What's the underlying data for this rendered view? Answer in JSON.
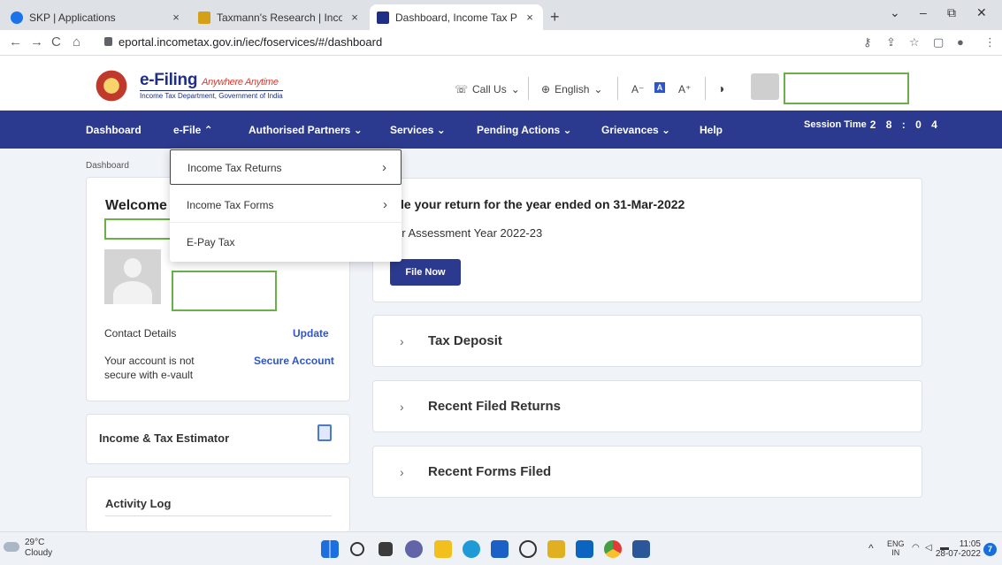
{
  "browser": {
    "tabs": [
      {
        "title": "SKP | Applications",
        "close": "×",
        "favicon_color": "#1a73e8"
      },
      {
        "title": "Taxmann's Research | Income Tax",
        "close": "×",
        "favicon_color": "#d4a017"
      },
      {
        "title": "Dashboard, Income Tax Portal, G",
        "close": "×",
        "favicon_color": "#1f2f86"
      }
    ],
    "new_tab": "+",
    "window_controls": [
      "⌄",
      "–",
      "⧉",
      "✕"
    ],
    "nav_buttons": [
      "←",
      "→",
      "C",
      "⌂"
    ],
    "url": "eportal.incometax.gov.in/iec/foservices/#/dashboard",
    "toolbar_icons": [
      "⚷",
      "⇪",
      "☆",
      "▢",
      "●",
      "⋮"
    ]
  },
  "site": {
    "logo_text": "e-Filing",
    "logo_tagline": "Anywhere Anytime",
    "logo_sub": "Income Tax Department, Government of India",
    "call_us": "Call Us",
    "language": "English",
    "font_controls": [
      "A⁻",
      "A",
      "A⁺"
    ],
    "contrast_icon": "◑"
  },
  "nav": {
    "items": [
      "Dashboard",
      "e-File ⌃",
      "Authorised Partners ⌄",
      "Services ⌄",
      "Pending Actions ⌄",
      "Grievances ⌄",
      "Help"
    ],
    "session_label": "Session Time",
    "session_digits": "2 8 : 0 4"
  },
  "dropdown": {
    "items": [
      "Income Tax Returns",
      "Income Tax Forms",
      "E-Pay Tax"
    ],
    "chevron": "›"
  },
  "main": {
    "breadcrumb": "Dashboard",
    "welcome": "Welcome I",
    "contact_label": "Contact Details",
    "update_link": "Update",
    "account_msg_1": "Your account is not",
    "account_msg_2": "secure with e-vault",
    "secure_link": "Secure Account",
    "estimator": "Income & Tax Estimator",
    "activity_log": "Activity Log",
    "banner_title": "le your return for the year ended on 31-Mar-2022",
    "banner_sub": "or Assessment Year 2022-23",
    "file_now": "File Now",
    "accordions": [
      "Tax Deposit",
      "Recent Filed Returns",
      "Recent Forms Filed"
    ],
    "accordion_chevron": "›"
  },
  "taskbar": {
    "temp": "29°C",
    "weather": "Cloudy",
    "lang_1": "ENG",
    "lang_2": "IN",
    "time": "11:05",
    "date": "28-07-2022",
    "notifications": "7",
    "tray_caret": "^"
  },
  "colors": {
    "nav_bg": "#2b3a8e",
    "link": "#2f55c7",
    "redaction_border": "#6aaf4a"
  }
}
